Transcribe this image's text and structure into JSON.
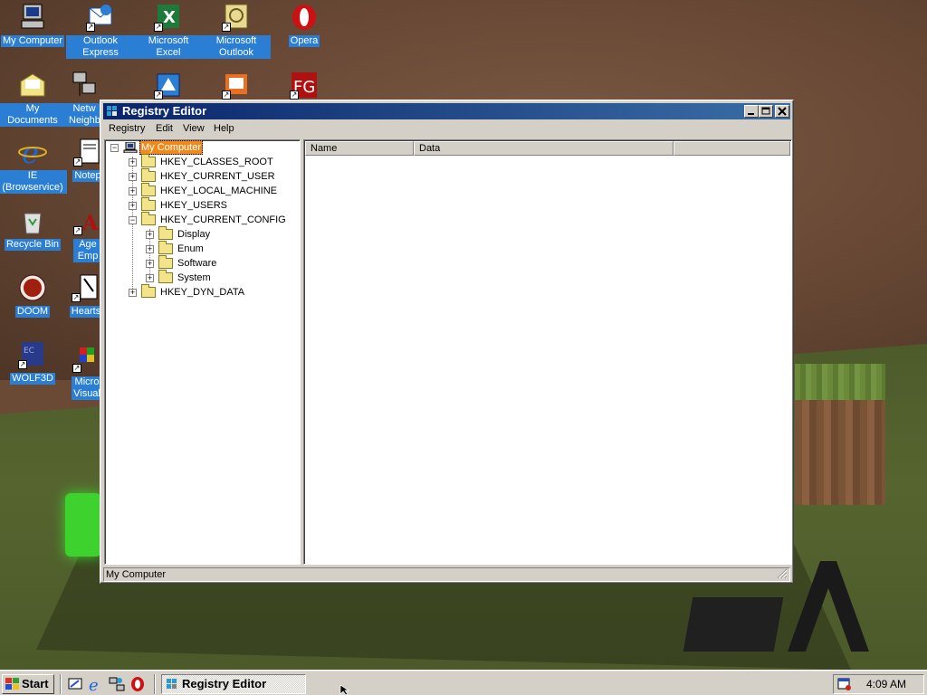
{
  "desktop": {
    "icons": [
      {
        "label": "My Computer",
        "icon": "my-computer-icon"
      },
      {
        "label": "Outlook Express",
        "icon": "outlook-express-icon"
      },
      {
        "label": "Microsoft Excel",
        "icon": "excel-icon"
      },
      {
        "label": "Microsoft Outlook",
        "icon": "outlook-icon"
      },
      {
        "label": "Opera",
        "icon": "opera-icon"
      },
      {
        "label": "My Documents",
        "icon": "my-documents-icon"
      },
      {
        "label": "Netw Neighb",
        "icon": "network-neighborhood-icon"
      },
      {
        "label": "",
        "icon": "dialer-icon"
      },
      {
        "label": "",
        "icon": "presentation-icon"
      },
      {
        "label": "",
        "icon": "fg-icon"
      },
      {
        "label": "IE (Browservice)",
        "icon": "internet-explorer-icon"
      },
      {
        "label": "Notep",
        "icon": "notepad-icon"
      },
      {
        "label": "Recycle Bin",
        "icon": "recycle-bin-icon"
      },
      {
        "label": "Age Emp",
        "icon": "age-of-empires-icon"
      },
      {
        "label": "DOOM",
        "icon": "doom-icon"
      },
      {
        "label": "Hearts",
        "icon": "hearts-icon"
      },
      {
        "label": "WOLF3D",
        "icon": "wolf3d-icon"
      },
      {
        "label": "Micro Visual",
        "icon": "visual-studio-icon"
      }
    ]
  },
  "window": {
    "title": "Registry Editor",
    "menu": [
      "Registry",
      "Edit",
      "View",
      "Help"
    ],
    "tree": {
      "root": "My Computer",
      "keys": [
        {
          "label": "HKEY_CLASSES_ROOT",
          "expander": "+"
        },
        {
          "label": "HKEY_CURRENT_USER",
          "expander": "+"
        },
        {
          "label": "HKEY_LOCAL_MACHINE",
          "expander": "+"
        },
        {
          "label": "HKEY_USERS",
          "expander": "+"
        },
        {
          "label": "HKEY_CURRENT_CONFIG",
          "expander": "−"
        },
        {
          "label": "Display",
          "expander": "+"
        },
        {
          "label": "Enum",
          "expander": "+"
        },
        {
          "label": "Software",
          "expander": "+"
        },
        {
          "label": "System",
          "expander": "+"
        },
        {
          "label": "HKEY_DYN_DATA",
          "expander": "+"
        }
      ]
    },
    "list": {
      "columns": [
        "Name",
        "Data"
      ]
    },
    "status": "My Computer"
  },
  "taskbar": {
    "start_label": "Start",
    "quick_launch": [
      "show-desktop-icon",
      "internet-explorer-icon",
      "network-icon",
      "opera-icon"
    ],
    "task_button_label": "Registry Editor",
    "clock": "4:09 AM"
  },
  "colors": {
    "title_active": "#0a246a",
    "desktop_label_bg": "#2a7fd4",
    "selection": "#ee8a1c",
    "face": "#d4d0c8"
  }
}
